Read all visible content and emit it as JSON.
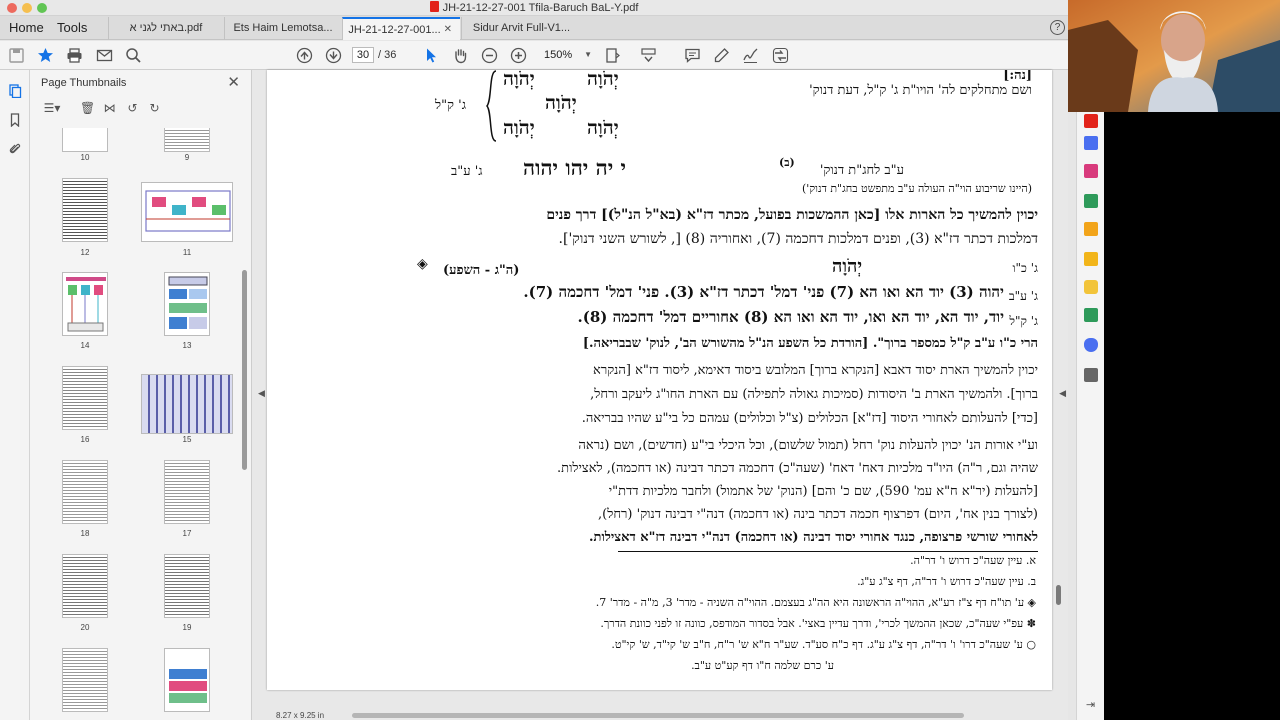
{
  "window": {
    "title": "JH-21-12-27-001 Tfila-Baruch BaL-Y.pdf"
  },
  "menu": {
    "home": "Home",
    "tools": "Tools"
  },
  "tabs": [
    {
      "label": "באתי לגני א.pdf"
    },
    {
      "label": "Ets Haim Lemotsa..."
    },
    {
      "label": "JH-21-12-27-001..."
    },
    {
      "label": "Sidur Arvit Full-V1..."
    }
  ],
  "toolbar": {
    "page_current": "30",
    "page_total": "/ 36",
    "zoom": "150%"
  },
  "thumbnails": {
    "title": "Page Thumbnails",
    "items": [
      {
        "label": "10"
      },
      {
        "label": "9"
      },
      {
        "label": "12"
      },
      {
        "label": "11"
      },
      {
        "label": "14"
      },
      {
        "label": "13"
      },
      {
        "label": "16"
      },
      {
        "label": "15"
      },
      {
        "label": "18"
      },
      {
        "label": "17"
      },
      {
        "label": "20"
      },
      {
        "label": "19"
      }
    ]
  },
  "document": {
    "top_cut": "[נה:]",
    "line1": "ושם מתחלקים לה' הויו\"ת ג' ק\"ל, דעת דנוק'",
    "tetra_top_left": "יְהֹוָה",
    "tetra_top_right": "יְהֹוָה",
    "tetra_mid": "יְהֹוָה",
    "tetra_bot_left": "יְהֹוָה",
    "tetra_bot_right": "יְהֹוָה",
    "gk_label": "ג' ק\"ל",
    "line_chagat": "ע\"ב לחג\"ת דנוק'",
    "marker_b": "(ב)",
    "divine_names": "י יה יהו יהוה",
    "gab": "ג' ע\"ב",
    "paren_note": "(היינו שריבוע הוי\"ה העולה ע\"ב מתפשט בחג\"ת דנוק')",
    "para1_l1": "יכוין להמשיך כל הארות אלו [כאן ההמשכות בפועל, מכתר דז\"א (בא\"ל הנ\"ל)] דרך פנים",
    "para1_l2": "דמלכות דכתר דז\"א (3), ופנים דמלכות דחכמה (7), ואחוריה (8) [, לשורש השני דנוק'].",
    "gkv_label": "ג' כ\"ו",
    "name_center": "יְהֹוָה",
    "hg_shefa": "(ה\"ג - השפע)",
    "marker_diamond": "◈",
    "gab2": "ג' ע\"ב",
    "row2": "יהוה (3)   יוד הא ואו הא (7)   פני' דמל' דכתר דז\"א (3). פני' דמל' דחכמה (7).",
    "gkl2": "ג' ק\"ל",
    "row3": "יוד, יוד הא, יוד הא ואו, יוד הא ואו הא (8)   אחוריים דמל' דחכמה (8).",
    "harei": "הרי כ\"ו ע\"ב ק\"ל כמספר ברוך\".   [הורדת כל השפע הנ\"ל מהשורש הב', לנוק' שבבריאה.]",
    "para2_l1": "יכוין להמשיך הארת יסוד דאבא [הנקרא ברוך] המלובש ביסוד דאימא, ליסוד דז\"א [הנקרא",
    "para2_l2": "ברוך]. ולהמשיך הארת ב' היסודות (סמיכות גאולה לתפילה) עם הארת החו\"ג ליעקב ורחל,",
    "para2_l3": "[כדי] להעלותם לאחורי היסוד [דז\"א] הכלולים (צ\"ל וכלולים) עמהם כל בי\"ע שהיו בבריאה.",
    "para3_l1": "וע\"י אורות הנ' יכוין להעלות נוק' רחל (תמול שלשום), וכל היכלי בי\"ע (חדשים), ושם (נראה",
    "para3_l2": "שהיה וגם, ר\"ה) היו\"ד מלכיות דאח' דאח' (שעה\"כ) דחכמה דכתר דבינה (או דחכמה), לאצילות.",
    "para3_l3": "[להעלות (יר\"א ח\"א עמ' 590), שם כ' והם] (הנוק' של אתמול) ולחבר מלכיות דדת\"י",
    "para3_l4": "(לצורך בנין אח', היום) דפרצוף חכמה דכתר בינה (או דחכמה) דנה\"י דבינה דנוק' (רחל),",
    "para3_l5": "לאחורי שורשי פרצופה, כנגד אחורי יסוד דבינה (או דחכמה) דנה\"י דבינה דז\"א דאצילות.",
    "fn_a": "א. עיין שעה\"כ דרוש ו' דר\"ה.",
    "fn_b": "ב. עיין שעה\"כ דרוש ו' דר\"ה, דף צ\"ג ע\"ג.",
    "fn_c": "◈ ע' תו\"ח דף צ\"ז רע\"א, ההוי\"ה הראשונה היא הה\"ג בעצמם. ההוי\"ה השניה - מדר' 3, מ\"ה - מדר' 7.",
    "fn_d": "✽ עפ\"י שעה\"כ, שכאן ההמשך לכרי', ודרך עדיין באצי'. אבל בסדור המודפס, כוונה זו לפני כוונת הדרך.",
    "fn_e": "○ ע' שעה\"כ דרו' ו' דר\"ה, דף צ\"ג ע\"ג. דף כ\"ח סע\"ד. שע\"ר ח\"א ש' ר\"ח, ח\"ב ש' קי\"ד, ש' קי\"ט.",
    "fn_f": "ע' כרם שלמה ח\"ו דף קע\"ט ע\"ב.",
    "page_size": "8.27 x 9.25 in"
  },
  "colors": {
    "accent": "#1473e6",
    "red_tools": "#e2231a",
    "pdf_icon": "#e2231a"
  }
}
